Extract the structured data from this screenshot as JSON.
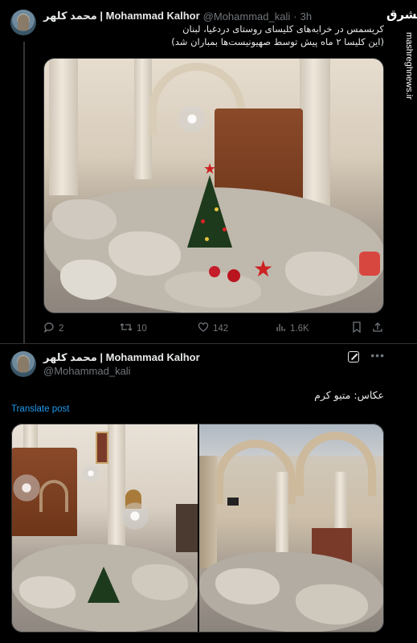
{
  "tweet1": {
    "name": "محمد کلهر | Mohammad Kalhor",
    "handle": "@Mohammad_kali",
    "time": "3h",
    "text_line1": "کریسمس در خرابه‌های کلیسای روستای دردغیا، لبنان",
    "text_line2": "(این کلیسا ۲ ماه پیش توسط صهیونیست‌ها بمباران شد)",
    "actions": {
      "replies": "2",
      "reposts": "10",
      "likes": "142",
      "views": "1.6K"
    }
  },
  "tweet2": {
    "name": "محمد کلهر | Mohammad Kalhor",
    "handle": "@Mohammad_kali",
    "text": "عکاس: متیو کرم",
    "translate_label": "Translate post"
  },
  "watermark": {
    "logo_text": "مشرق",
    "url": "mashreghnews.ir"
  },
  "icons": {
    "reply": "reply-icon",
    "repost": "repost-icon",
    "like": "heart-icon",
    "views": "analytics-icon",
    "bookmark": "bookmark-icon",
    "share": "share-icon",
    "grok": "grok-icon",
    "more": "more-icon"
  },
  "colors": {
    "background": "#000000",
    "text": "#e7e9ea",
    "muted": "#71767b",
    "link": "#1d9bf0",
    "border": "#2f3336"
  }
}
